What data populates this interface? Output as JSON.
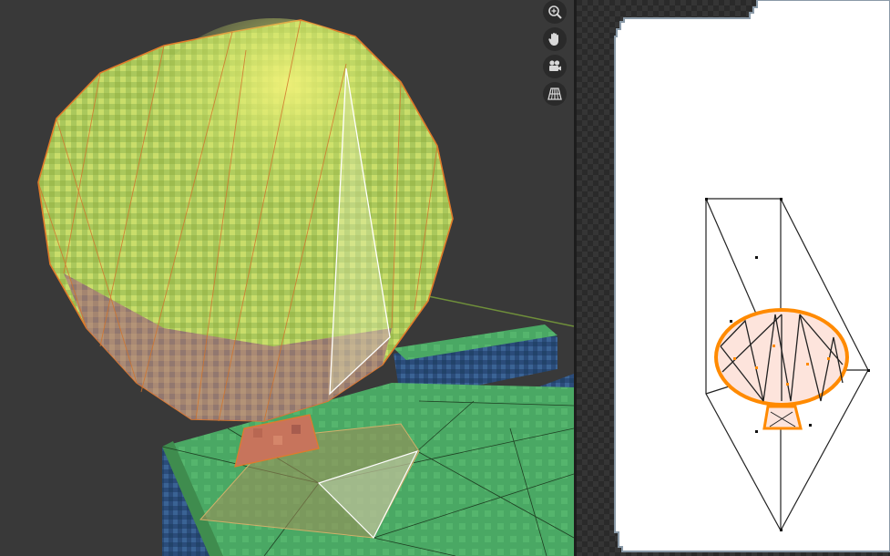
{
  "viewport": {
    "navigation_tools": [
      {
        "name": "zoom",
        "icon": "zoom-in-icon"
      },
      {
        "name": "pan",
        "icon": "hand-icon"
      },
      {
        "name": "camera",
        "icon": "camera-icon"
      },
      {
        "name": "perspective",
        "icon": "grid-icon"
      }
    ]
  },
  "uv_editor": {
    "texture_background": "#ffffff",
    "selection_color": "#ff8a00"
  },
  "colors": {
    "viewport_bg": "#393939",
    "tree_foliage": "#b7d35a",
    "grass": "#4aa864",
    "selection_outline": "#e07b2a"
  }
}
